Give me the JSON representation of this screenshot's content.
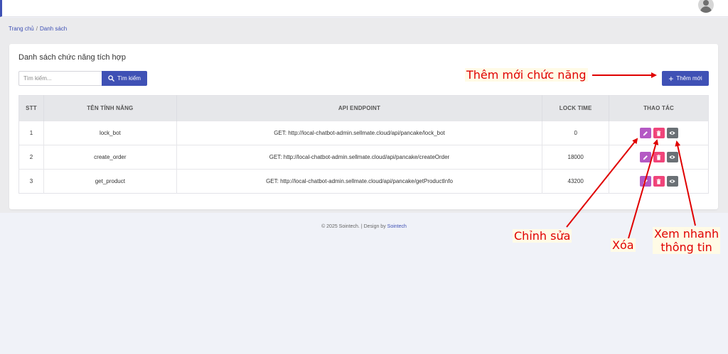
{
  "breadcrumb": {
    "home": "Trang chủ",
    "separator": "/",
    "current": "Danh sách"
  },
  "card": {
    "title": "Danh sách chức năng tích hợp"
  },
  "search": {
    "placeholder": "Tìm kiếm...",
    "button_label": "Tìm kiếm"
  },
  "add_button": {
    "label": "Thêm mới"
  },
  "table": {
    "headers": [
      "STT",
      "TÊN TÍNH NĂNG",
      "API ENDPOINT",
      "LOCK TIME",
      "THAO TÁC"
    ],
    "rows": [
      {
        "stt": "1",
        "name": "lock_bot",
        "endpoint": "GET: http://local-chatbot-admin.sellmate.cloud/api/pancake/lock_bot",
        "lock_time": "0"
      },
      {
        "stt": "2",
        "name": "create_order",
        "endpoint": "GET: http://local-chatbot-admin.sellmate.cloud/api/pancake/createOrder",
        "lock_time": "18000"
      },
      {
        "stt": "3",
        "name": "get_product",
        "endpoint": "GET: http://local-chatbot-admin.sellmate.cloud/api/pancake/getProductInfo",
        "lock_time": "43200"
      }
    ]
  },
  "footer": {
    "text": "© 2025 Sointech. | Design by",
    "link": "Sointech"
  },
  "annotations": {
    "add": "Thêm mới chức năng",
    "edit": "Chỉnh sửa",
    "delete": "Xóa",
    "view_line1": "Xem nhanh",
    "view_line2": "thông tin"
  },
  "colors": {
    "primary": "#3f51b5",
    "edit": "#b459c4",
    "delete": "#f0447a",
    "view": "#6a7075",
    "annotation": "#e00000"
  },
  "icons": {
    "search": "search-icon",
    "add": "plus-icon",
    "edit": "pencil-icon",
    "delete": "trash-icon",
    "view": "eye-icon",
    "avatar": "user-avatar-icon"
  }
}
